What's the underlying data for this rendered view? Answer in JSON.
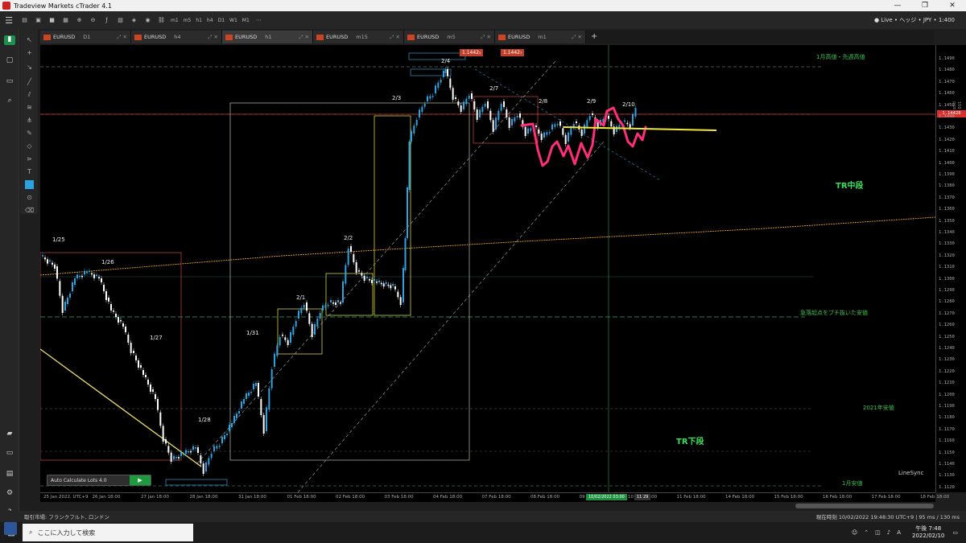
{
  "window": {
    "title": "Tradeview Markets cTrader 4.1",
    "min": "—",
    "max": "❐",
    "close": "✕"
  },
  "toolbar": {
    "timeframes": [
      "m1",
      "m5",
      "h1",
      "h4",
      "D1",
      "W1",
      "M1"
    ],
    "account": "● Live • ヘッジ • JPY • 1:400"
  },
  "tabs": [
    {
      "symbol": "EURUSD",
      "tf": "D1"
    },
    {
      "symbol": "EURUSD",
      "tf": "h4"
    },
    {
      "symbol": "EURUSD",
      "tf": "h1"
    },
    {
      "symbol": "EURUSD",
      "tf": "m15"
    },
    {
      "symbol": "EURUSD",
      "tf": "m5"
    },
    {
      "symbol": "EURUSD",
      "tf": "m1"
    }
  ],
  "tab_add": "+",
  "chart": {
    "current_price": "1.14428",
    "pips_label": "100 pips",
    "price_tag_sell": "1.1442₅",
    "price_tag_buy": "1.1442₇",
    "y_ticks": [
      "1.1490",
      "1.1480",
      "1.1470",
      "1.1460",
      "1.1450",
      "1.1440",
      "1.1430",
      "1.1420",
      "1.1410",
      "1.1400",
      "1.1390",
      "1.1380",
      "1.1370",
      "1.1360",
      "1.1350",
      "1.1340",
      "1.1330",
      "1.1320",
      "1.1310",
      "1.1300",
      "1.1290",
      "1.1280",
      "1.1270",
      "1.1260",
      "1.1250",
      "1.1240",
      "1.1230",
      "1.1220",
      "1.1210",
      "1.1200",
      "1.1190",
      "1.1180",
      "1.1170",
      "1.1160",
      "1.1150",
      "1.1140",
      "1.1130",
      "1.1120"
    ],
    "x_ticks": [
      "25 Jan 2022, UTC+9",
      "26 Jan 18:00",
      "27 Jan 18:00",
      "28 Jan 18:00",
      "31 Jan 18:00",
      "01 Feb 18:00",
      "02 Feb 18:00",
      "03 Feb 18:00",
      "04 Feb 18:00",
      "07 Feb 18:00",
      "08 Feb 18:00",
      "09 Feb 18:00",
      "10 Feb 18:00",
      "11 Feb 18:00",
      "14 Feb 18:00",
      "15 Feb 18:00",
      "16 Feb 18:00",
      "17 Feb 18:00",
      "18 Feb 18:00"
    ],
    "x_cursor": "10/02/2022 03:00",
    "x_cursor2": "11 29",
    "day_labels": [
      "1/25",
      "1/26",
      "1/27",
      "1/28",
      "1/31",
      "2/1",
      "2/2",
      "2/3",
      "2/4",
      "2/7",
      "2/8",
      "2/9",
      "2/10"
    ],
    "level_labels": {
      "jan_high": "1月高値・先週高値",
      "drop_origin": "急落起点をブチ抜いた安値",
      "y2021_low": "2021年安値",
      "jan_low": "1月安値"
    },
    "zone_mid": "TR中段",
    "zone_low": "TR下段",
    "linesync": "LineSync",
    "auto_lots": "Auto Calculate Lots 4.0",
    "play": "▶",
    "colors": {
      "bull": "#2ea3e0",
      "bear": "#ffffff",
      "price_line": "#d9302f",
      "annotation": "#ff2d7a",
      "support": "#f3e83a"
    }
  },
  "status": {
    "left": "取引市場: フランクフルト, ロンドン",
    "right": "現在時刻 10/02/2022 19:48:30   UTC+9   |  95 ms / 130 ms"
  },
  "taskbar": {
    "start": "⊞",
    "search_placeholder": "ここに入力して検索",
    "time": "午後 7:48",
    "date": "2022/02/10",
    "lang": "A"
  }
}
